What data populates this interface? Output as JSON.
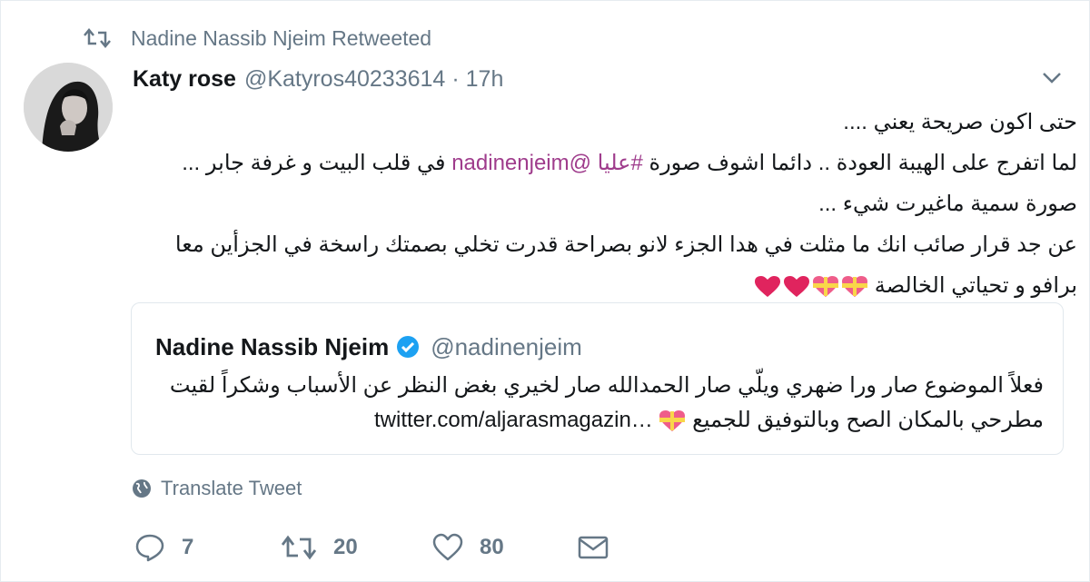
{
  "retweet_context": {
    "icon": "retweet-icon",
    "text": "Nadine Nassib Njeim Retweeted"
  },
  "tweet": {
    "author_name": "Katy rose",
    "handle": "@Katyros40233614",
    "separator": "·",
    "time": "17h",
    "line1": "حتى اكون صريحة يعني ....",
    "line2_start": "لما اتفرج على الهيبة العودة .. دائما اشوف صورة ",
    "line2_hashtag": "#عليا",
    "line2_mention": "@nadinenjeim",
    "line2_end": "  في قلب البيت و غرفة جابر ...",
    "line3": "صورة سمية ماغيرت شيء ...",
    "line4": "عن جد قرار صائب انك ما مثلت في هدا الجزء لانو بصراحة قدرت تخلي بصمتك راسخة في الجزأين معا",
    "line5_text": "برافو و تحياتي الخالصة",
    "hearts": [
      "ribbon-heart-icon",
      "ribbon-heart-icon",
      "red-heart-icon",
      "red-heart-icon"
    ]
  },
  "quote": {
    "author_name": "Nadine Nassib Njeim",
    "verified_icon": "verified-badge-icon",
    "handle": "@nadinenjeim",
    "line1": "فعلاً الموضوع صار ورا ضهري ويلّي صار الحمدالله صار لخيري بغض النظر عن الأسباب وشكراً لقيت",
    "line2_text": "مطرحي بالمكان الصح وبالتوفيق للجميع",
    "line2_link": "twitter.com/aljarasmagazin…"
  },
  "translate_label": "Translate Tweet",
  "actions": {
    "replies": "7",
    "retweets": "20",
    "likes": "80"
  },
  "colors": {
    "secondary": "#657786",
    "mention": "#9f3c8c",
    "heart": "#e0245e",
    "verified": "#1da1f2"
  }
}
